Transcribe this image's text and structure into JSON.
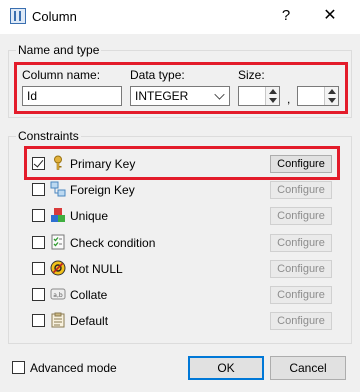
{
  "window": {
    "title": "Column",
    "help": "?",
    "close": "✕"
  },
  "name_type": {
    "group_title": "Name and type",
    "column_name_label": "Column name:",
    "column_name_value": "Id",
    "data_type_label": "Data type:",
    "data_type_value": "INTEGER",
    "size_label": "Size:",
    "size_separator": ","
  },
  "constraints": {
    "group_title": "Constraints",
    "items": [
      {
        "label": "Primary Key",
        "checked": true,
        "button": "Configure",
        "enabled": true,
        "icon": "key-icon"
      },
      {
        "label": "Foreign Key",
        "checked": false,
        "button": "Configure",
        "enabled": false,
        "icon": "foreign-key-icon"
      },
      {
        "label": "Unique",
        "checked": false,
        "button": "Configure",
        "enabled": false,
        "icon": "unique-icon"
      },
      {
        "label": "Check condition",
        "checked": false,
        "button": "Configure",
        "enabled": false,
        "icon": "check-condition-icon"
      },
      {
        "label": "Not NULL",
        "checked": false,
        "button": "Configure",
        "enabled": false,
        "icon": "not-null-icon"
      },
      {
        "label": "Collate",
        "checked": false,
        "button": "Configure",
        "enabled": false,
        "icon": "collate-icon"
      },
      {
        "label": "Default",
        "checked": false,
        "button": "Configure",
        "enabled": false,
        "icon": "default-icon"
      }
    ]
  },
  "footer": {
    "advanced_label": "Advanced mode",
    "ok": "OK",
    "cancel": "Cancel"
  },
  "colors": {
    "highlight": "#e31b2a",
    "focus": "#0078d7"
  }
}
